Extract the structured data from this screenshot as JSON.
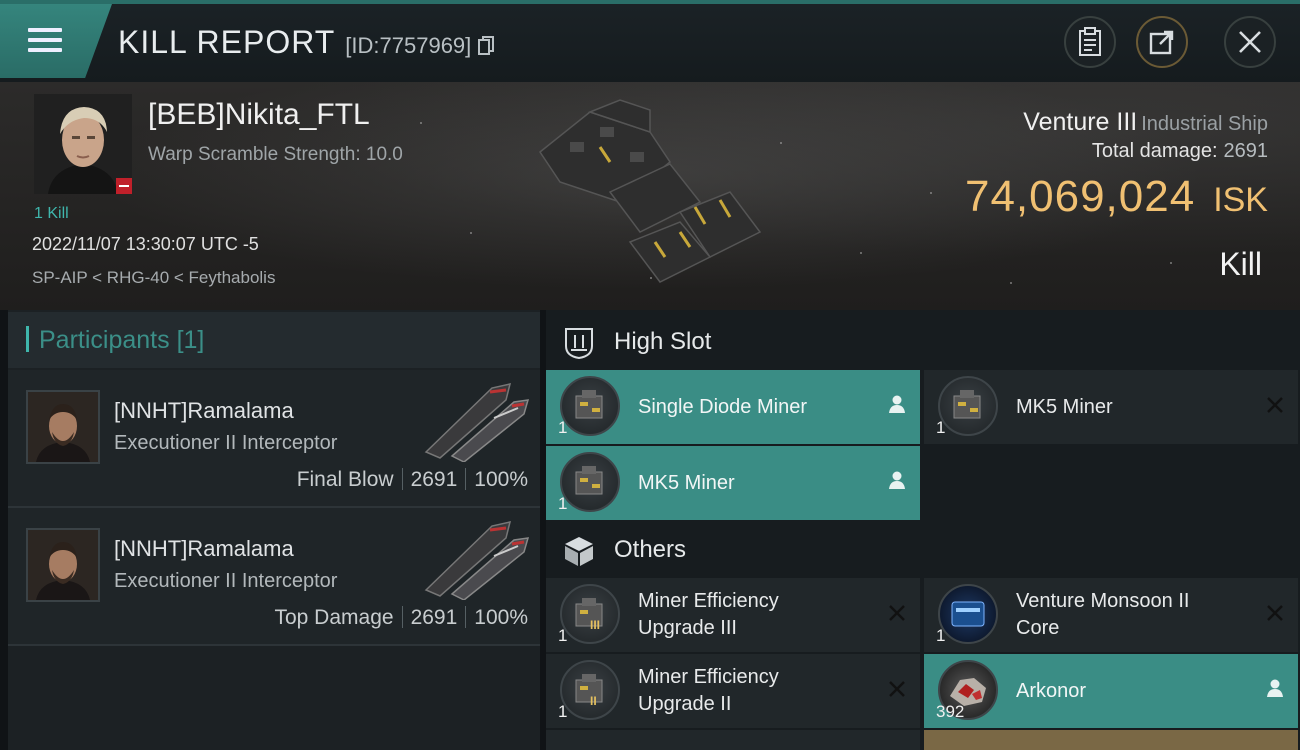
{
  "header": {
    "title": "KILL REPORT",
    "report_id": "[ID:7757969]"
  },
  "victim": {
    "name": "[BEB]Nikita_FTL",
    "warp_scramble": "Warp Scramble Strength: 10.0",
    "kills": "1 Kill",
    "timestamp": "2022/11/07 13:30:07 UTC -5",
    "location": "SP-AIP < RHG-40 < Feythabolis",
    "ship_name": "Venture III",
    "ship_class": "Industrial Ship",
    "damage_label": "Total damage:",
    "damage_value": "2691",
    "isk_value": "74,069,024",
    "isk_unit": "ISK",
    "result": "Kill"
  },
  "participants": {
    "title": "Participants",
    "count": "[1]",
    "rows": [
      {
        "name": "[NNHT]Ramalama",
        "ship": "Executioner II Interceptor",
        "tag": "Final Blow",
        "damage": "2691",
        "percent": "100%"
      },
      {
        "name": "[NNHT]Ramalama",
        "ship": "Executioner II Interceptor",
        "tag": "Top Damage",
        "damage": "2691",
        "percent": "100%"
      }
    ]
  },
  "high_slot": {
    "title": "High Slot",
    "items": [
      {
        "name": "Single Diode Miner",
        "qty": "1",
        "status": "dropped"
      },
      {
        "name": "MK5 Miner",
        "qty": "1",
        "status": "destroyed"
      },
      {
        "name": "MK5 Miner",
        "qty": "1",
        "status": "dropped"
      }
    ]
  },
  "others": {
    "title": "Others",
    "items": [
      {
        "name": "Miner Efficiency Upgrade III",
        "line1": "Miner Efficiency",
        "line2": "Upgrade III",
        "qty": "1",
        "status": "destroyed",
        "tier": "III"
      },
      {
        "name": "Venture Monsoon II Core",
        "line1": "Venture Monsoon II",
        "line2": "Core",
        "qty": "1",
        "status": "destroyed"
      },
      {
        "name": "Miner Efficiency Upgrade II",
        "line1": "Miner Efficiency",
        "line2": "Upgrade II",
        "qty": "1",
        "status": "destroyed",
        "tier": "II"
      },
      {
        "name": "Arkonor",
        "qty": "392",
        "status": "dropped"
      }
    ]
  },
  "colors": {
    "accent": "#3a8d85",
    "isk": "#f0c072",
    "kill_count": "#3fb6ac"
  }
}
